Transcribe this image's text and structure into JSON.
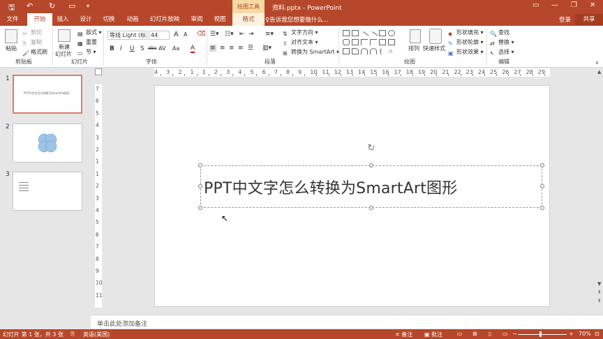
{
  "titlebar": {
    "doc_title": "资料.pptx - PowerPoint",
    "context_tools": "绘图工具",
    "quick_access": [
      "save-icon",
      "undo-icon",
      "redo-icon",
      "slideshow-icon"
    ]
  },
  "tabs": {
    "file": "文件",
    "home": "开始",
    "insert": "插入",
    "design": "设计",
    "transitions": "切换",
    "animations": "动画",
    "slideshow": "幻灯片放映",
    "review": "审阅",
    "view": "视图",
    "format": "格式",
    "tell_me": "♀告诉我您想要做什么...",
    "sign_in": "登录",
    "share": "共享"
  },
  "ribbon": {
    "clipboard": {
      "label": "剪贴板",
      "paste": "粘贴",
      "cut": "剪切",
      "copy": "复制",
      "format_painter": "格式刷"
    },
    "slides": {
      "label": "幻灯片",
      "new_slide": "新建",
      "new_slide2": "幻灯片",
      "layout": "版式",
      "reset": "重置",
      "section": "节"
    },
    "font": {
      "label": "字体",
      "font_name": "等线 Light (标",
      "font_size": "44",
      "buttons": [
        "B",
        "I",
        "U",
        "S",
        "abc",
        "AV",
        "Aa",
        "A"
      ]
    },
    "paragraph": {
      "label": "段落",
      "text_direction": "文字方向",
      "align_text": "对齐文本",
      "convert_smartart": "转换为 SmartArt"
    },
    "drawing": {
      "label": "绘图",
      "arrange": "排列",
      "quick_styles": "快速样式",
      "shape_fill": "形状填充",
      "shape_outline": "形状轮廓",
      "shape_effects": "形状效果"
    },
    "editing": {
      "label": "编辑",
      "find": "查找",
      "replace": "替换",
      "select": "选择"
    }
  },
  "ruler": {
    "h_numbers": [
      "4",
      "3",
      "2",
      "1",
      "1",
      "2",
      "3",
      "4",
      "5",
      "6",
      "7",
      "8",
      "9",
      "10",
      "11",
      "12",
      "13",
      "14",
      "15",
      "16",
      "17",
      "18",
      "19",
      "20",
      "21",
      "22",
      "23",
      "24",
      "25",
      "26",
      "27",
      "28",
      "29"
    ],
    "v_numbers": [
      "7",
      "6",
      "5",
      "4",
      "3",
      "2",
      "1",
      "1",
      "2",
      "3",
      "4",
      "5",
      "6",
      "7",
      "8",
      "9",
      "10",
      "11"
    ]
  },
  "thumbnails": [
    {
      "num": "1",
      "text": "PPT中文字怎么转换为SmartArt图形"
    },
    {
      "num": "2",
      "text": ""
    },
    {
      "num": "3",
      "text": ""
    }
  ],
  "slide": {
    "title": "PPT中文字怎么转换为SmartArt图形"
  },
  "notes": {
    "placeholder": "单击此处添加备注"
  },
  "statusbar": {
    "slide_info": "幻灯片 第 1 张，共 3 张",
    "language": "英语(美国)",
    "notes": "备注",
    "comments": "批注",
    "zoom": "70%"
  },
  "colors": {
    "accent": "#b7472a",
    "context": "#f8d9a5"
  }
}
